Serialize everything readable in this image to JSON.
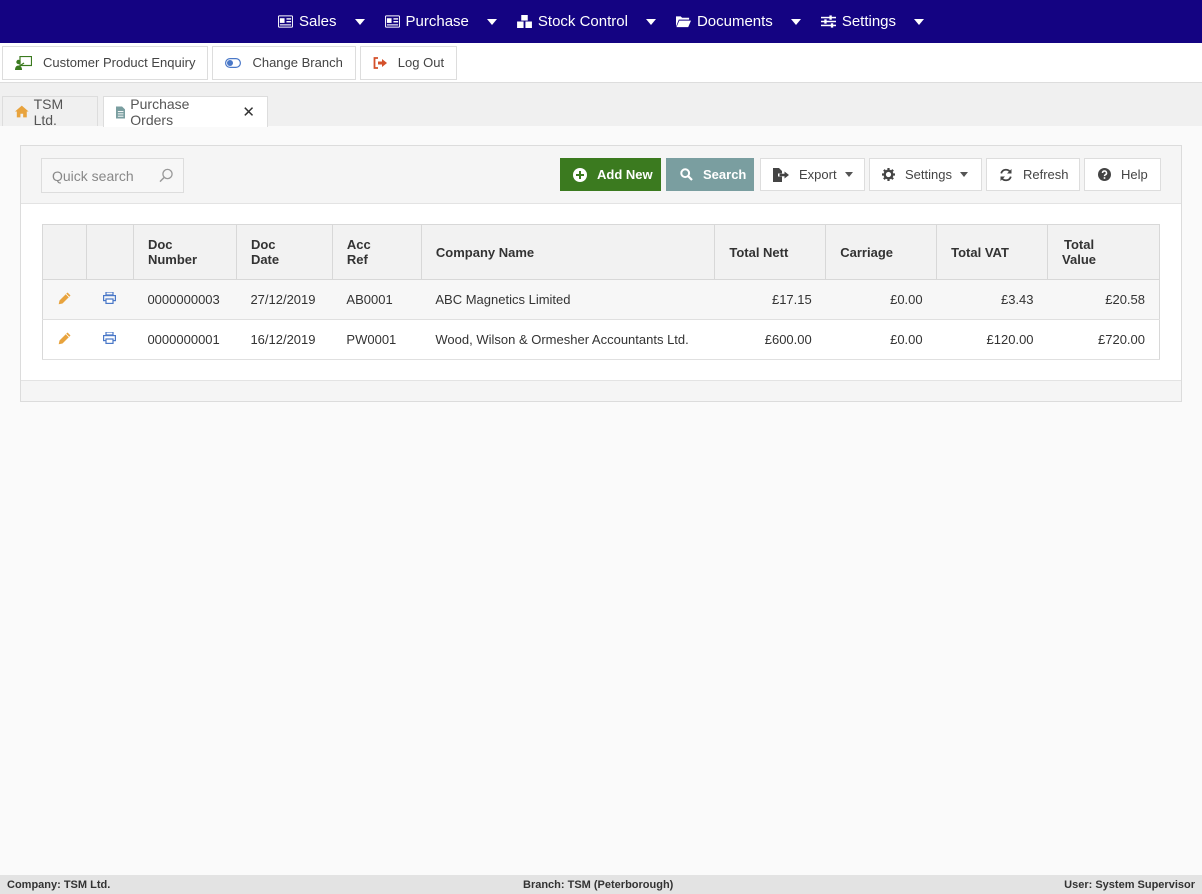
{
  "nav": {
    "items": [
      {
        "label": "Sales",
        "icon": "id-card-icon"
      },
      {
        "label": "Purchase",
        "icon": "id-card-icon"
      },
      {
        "label": "Stock Control",
        "icon": "boxes-icon"
      },
      {
        "label": "Documents",
        "icon": "folder-open-icon"
      },
      {
        "label": "Settings",
        "icon": "sliders-icon"
      }
    ],
    "bg_color": "#140382"
  },
  "toolbar": {
    "customer_enquiry": "Customer Product Enquiry",
    "change_branch": "Change Branch",
    "log_out": "Log Out"
  },
  "tabs": {
    "home": "TSM Ltd.",
    "purchase_orders": "Purchase Orders",
    "close": "✕"
  },
  "panel": {
    "quick_search_placeholder": "Quick search",
    "add_new": "Add New",
    "search": "Search",
    "export": "Export",
    "settings": "Settings",
    "refresh": "Refresh",
    "help": "Help",
    "add_new_color": "#3b7a1f",
    "search_color": "#7a9ea0"
  },
  "table": {
    "headers": {
      "doc_number": [
        "Doc",
        "Number"
      ],
      "doc_date": [
        "Doc",
        "Date"
      ],
      "acc_ref": [
        "Acc",
        "Ref"
      ],
      "company_name": "Company Name",
      "total_nett": "Total Nett",
      "carriage": "Carriage",
      "total_vat": "Total VAT",
      "total_value": [
        "Total",
        "Value"
      ]
    },
    "rows": [
      {
        "doc_number": "0000000003",
        "doc_date": "27/12/2019",
        "acc_ref": "AB0001",
        "company_name": "ABC Magnetics Limited",
        "total_nett": "£17.15",
        "carriage": "£0.00",
        "total_vat": "£3.43",
        "total_value": "£20.58"
      },
      {
        "doc_number": "0000000001",
        "doc_date": "16/12/2019",
        "acc_ref": "PW0001",
        "company_name": "Wood, Wilson & Ormesher Accountants Ltd.",
        "total_nett": "£600.00",
        "carriage": "£0.00",
        "total_vat": "£120.00",
        "total_value": "£720.00"
      }
    ]
  },
  "status": {
    "company": "Company: TSM Ltd.",
    "branch": "Branch: TSM (Peterborough)",
    "user": "User: System Supervisor"
  }
}
